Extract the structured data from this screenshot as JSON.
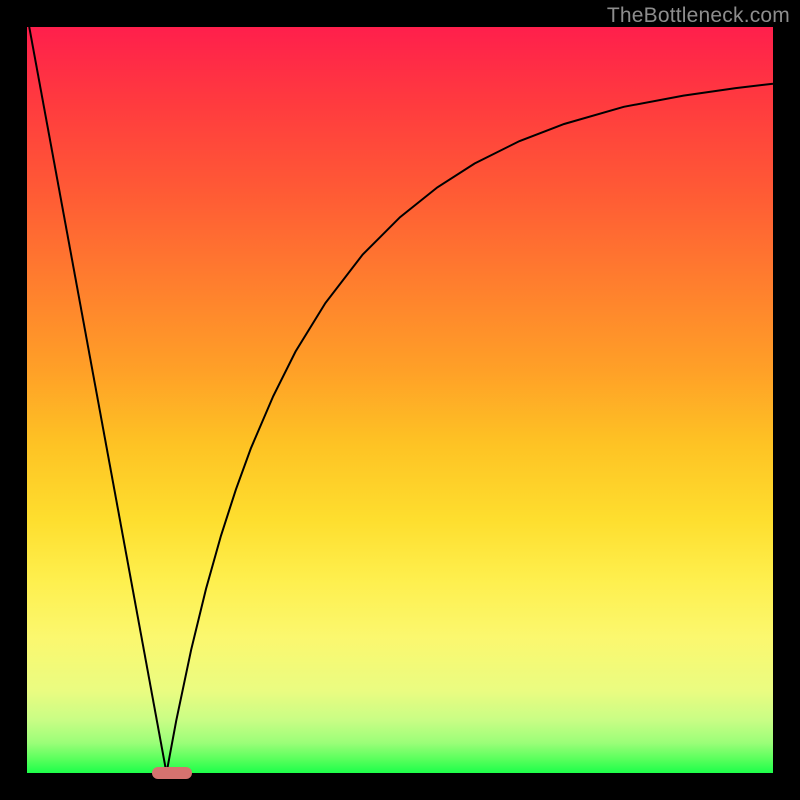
{
  "watermark": "TheBottleneck.com",
  "chart_data": {
    "type": "line",
    "title": "",
    "xlabel": "",
    "ylabel": "",
    "xlim": [
      0,
      100
    ],
    "ylim": [
      0,
      100
    ],
    "gradient_colors": {
      "top": "#ff1f4c",
      "mid": "#fee033",
      "bottom": "#1dff4a"
    },
    "series": [
      {
        "name": "left-line",
        "stroke": "#000000",
        "x": [
          0.3,
          18.7
        ],
        "values": [
          100,
          0
        ]
      },
      {
        "name": "right-curve",
        "stroke": "#000000",
        "x": [
          18.7,
          20,
          22,
          24,
          26,
          28,
          30,
          33,
          36,
          40,
          45,
          50,
          55,
          60,
          66,
          72,
          80,
          88,
          95,
          100
        ],
        "values": [
          0,
          7,
          16.5,
          24.7,
          31.8,
          38,
          43.5,
          50.5,
          56.5,
          63,
          69.5,
          74.5,
          78.5,
          81.7,
          84.7,
          87,
          89.3,
          90.8,
          91.8,
          92.4
        ]
      }
    ],
    "marker": {
      "x": 19.5,
      "y": 0,
      "color": "#d6726f"
    }
  }
}
